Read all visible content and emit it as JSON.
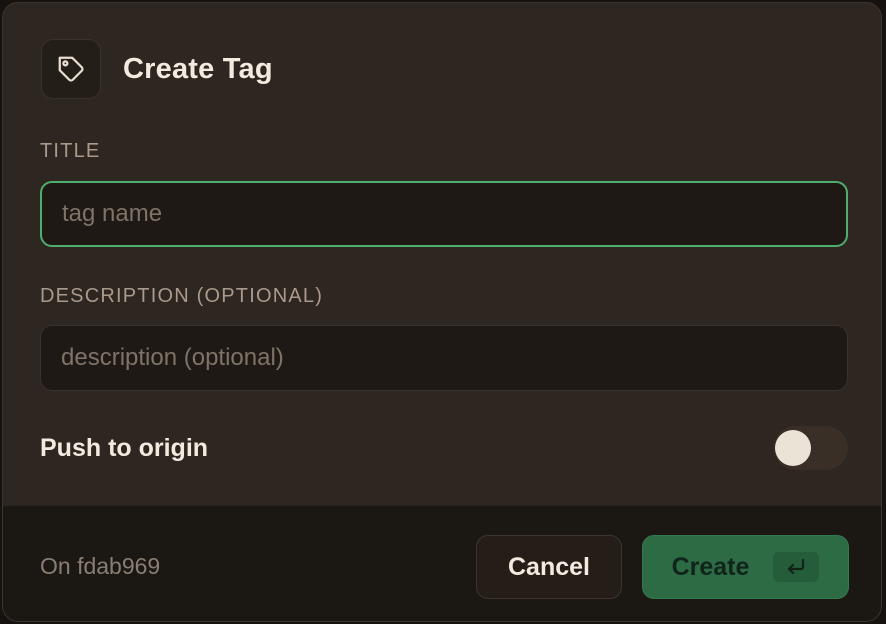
{
  "dialog": {
    "title": "Create Tag",
    "icon": "tag-icon"
  },
  "title_field": {
    "label": "TITLE",
    "placeholder": "tag name",
    "value": ""
  },
  "description_field": {
    "label": "DESCRIPTION (OPTIONAL)",
    "placeholder": "description (optional)",
    "value": ""
  },
  "push": {
    "label": "Push to origin",
    "enabled": false
  },
  "footer": {
    "commit": "On fdab969",
    "cancel_label": "Cancel",
    "create_label": "Create",
    "enter_icon": "enter-key-icon"
  },
  "colors": {
    "background": "#2e2620",
    "footer": "#1b1713",
    "focus_border": "#4fae6d",
    "create_button": "#2c6b44",
    "text": "#f2ebe0"
  }
}
